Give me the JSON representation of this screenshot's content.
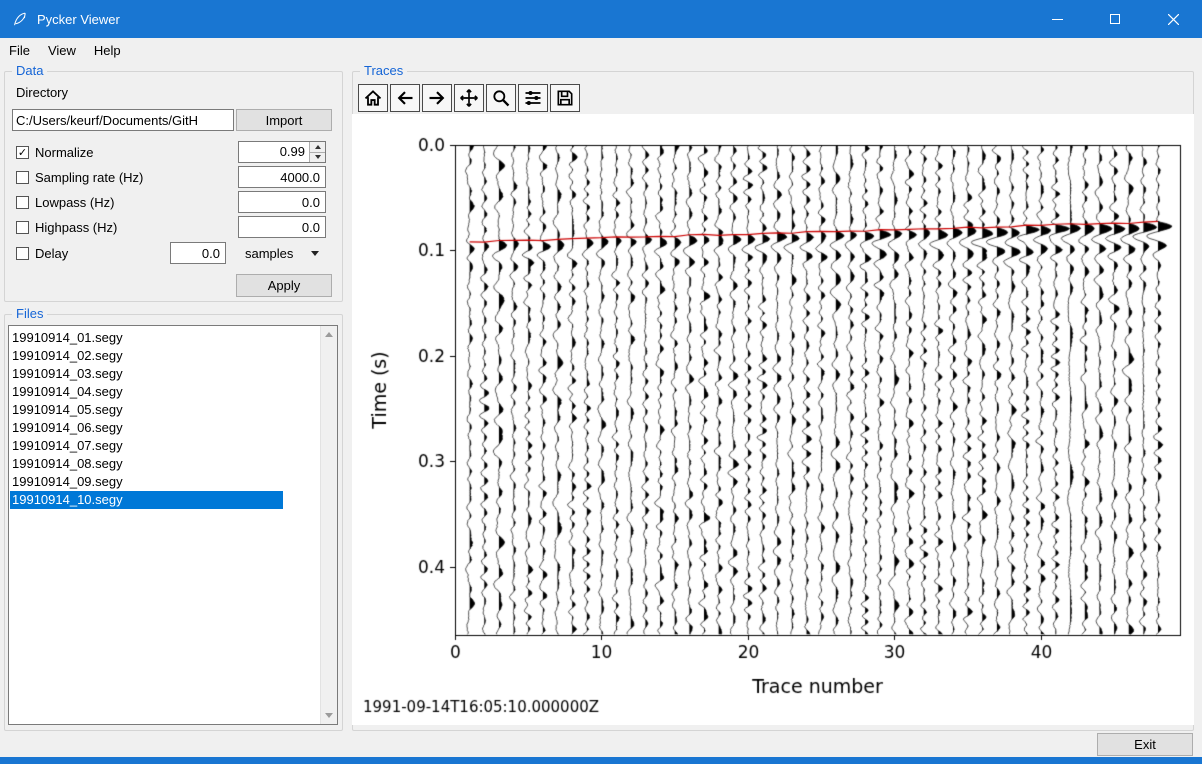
{
  "window": {
    "title": "Pycker Viewer",
    "controls": [
      "minimize",
      "maximize",
      "close"
    ]
  },
  "menu": {
    "items": [
      "File",
      "View",
      "Help"
    ]
  },
  "data_panel": {
    "title": "Data",
    "directory_label": "Directory",
    "directory_value": "C:/Users/keurf/Documents/GitH",
    "import_label": "Import",
    "rows": [
      {
        "label": "Normalize",
        "checked": true,
        "value": "0.99",
        "widget": "spinbox"
      },
      {
        "label": "Sampling rate (Hz)",
        "checked": false,
        "value": "4000.0",
        "widget": "field"
      },
      {
        "label": "Lowpass (Hz)",
        "checked": false,
        "value": "0.0",
        "widget": "field"
      },
      {
        "label": "Highpass (Hz)",
        "checked": false,
        "value": "0.0",
        "widget": "field"
      }
    ],
    "delay": {
      "label": "Delay",
      "checked": false,
      "value": "0.0",
      "unit": "samples"
    },
    "apply_label": "Apply"
  },
  "files_panel": {
    "title": "Files",
    "items": [
      "19910914_01.segy",
      "19910914_02.segy",
      "19910914_03.segy",
      "19910914_04.segy",
      "19910914_05.segy",
      "19910914_06.segy",
      "19910914_07.segy",
      "19910914_08.segy",
      "19910914_09.segy",
      "19910914_10.segy"
    ],
    "selected_index": 9
  },
  "traces_panel": {
    "title": "Traces",
    "toolbar": [
      "home",
      "back",
      "forward",
      "pan",
      "zoom",
      "configure",
      "save"
    ],
    "timestamp": "1991-09-14T16:05:10.000000Z"
  },
  "exit_label": "Exit",
  "colors": {
    "titlebar": "#1976d2",
    "accent_blue": "#1565d6",
    "selection": "#0078d7"
  },
  "chart_data": {
    "type": "seismic-wiggle",
    "title": "",
    "xlabel": "Trace number",
    "ylabel": "Time (s)",
    "xlim": [
      0,
      49.5
    ],
    "ylim": [
      0,
      0.465
    ],
    "xticks": [
      0,
      10,
      20,
      30,
      40
    ],
    "xtick_labels": [
      "0",
      "10",
      "20",
      "30",
      "40"
    ],
    "yticks": [
      0,
      0.1,
      0.2,
      0.3,
      0.4
    ],
    "ytick_labels": [
      "0.0",
      "0.1",
      "0.2",
      "0.3",
      "0.4"
    ],
    "grid": false,
    "n_traces": 48,
    "pick_line": {
      "color": "#cc0000",
      "t_first": 0.092,
      "t_last": 0.073
    },
    "burst": {
      "freq_hz": 52,
      "decay_s": 0.028,
      "amp_base": 3.5,
      "amp_grow": 0.21
    },
    "noise_amp": 1.5
  }
}
